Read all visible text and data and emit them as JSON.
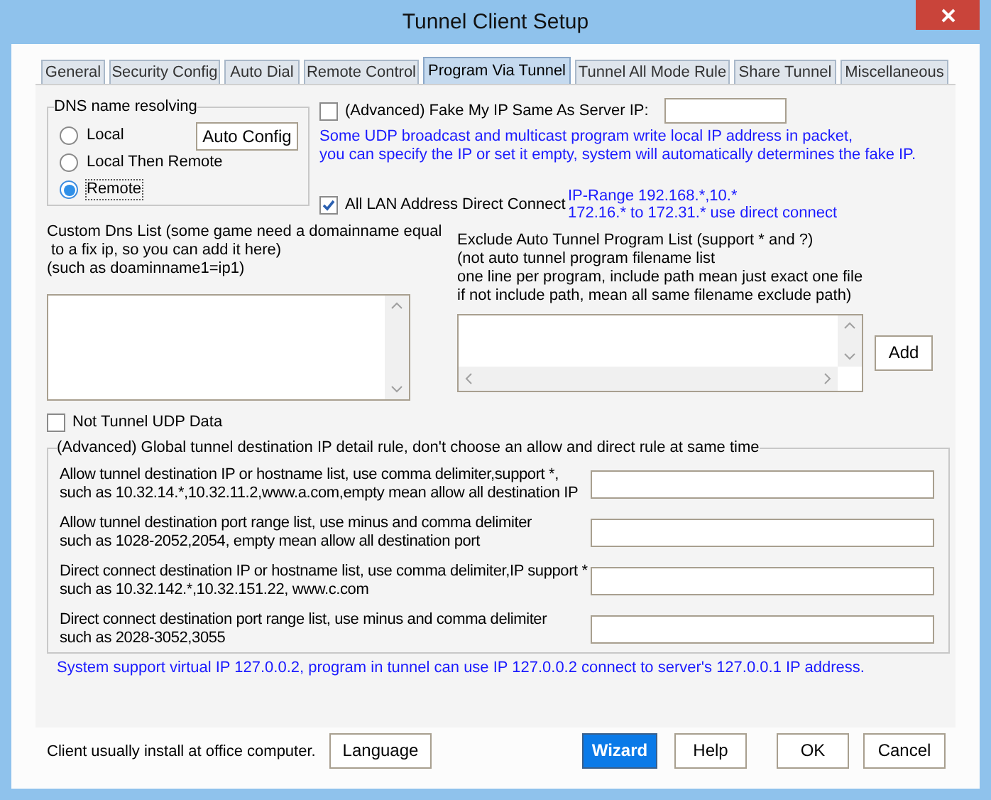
{
  "window": {
    "title": "Tunnel Client Setup"
  },
  "tabs": [
    {
      "label": "General",
      "selected": false
    },
    {
      "label": "Security Config",
      "selected": false
    },
    {
      "label": "Auto Dial",
      "selected": false
    },
    {
      "label": "Remote Control",
      "selected": false
    },
    {
      "label": "Program Via Tunnel",
      "selected": true
    },
    {
      "label": "Tunnel All Mode Rule",
      "selected": false
    },
    {
      "label": "Share Tunnel",
      "selected": false
    },
    {
      "label": "Miscellaneous",
      "selected": false
    }
  ],
  "dns_group": {
    "title": "DNS name resolving",
    "options": [
      {
        "label": "Local",
        "selected": false
      },
      {
        "label": "Local Then Remote",
        "selected": false
      },
      {
        "label": "Remote",
        "selected": true
      }
    ],
    "auto_config_button": "Auto Config"
  },
  "fake_ip": {
    "label": "(Advanced) Fake My IP Same As Server IP:",
    "checked": false
  },
  "fake_ip_note": [
    "Some UDP broadcast and multicast program write local IP address in packet,",
    "you can specify the IP or set it empty, system will automatically determines the fake IP."
  ],
  "all_lan": {
    "label": "All LAN Address Direct Connect",
    "checked": true
  },
  "ip_range_note": [
    "IP-Range 192.168.*,10.*",
    "172.16.* to 172.31.* use direct connect"
  ],
  "custom_dns": {
    "label": [
      "Custom Dns List (some game need a domainname equal",
      "to a fix ip, so you can add it here)",
      "(such as doaminname1=ip1)"
    ]
  },
  "exclude_list": {
    "label": [
      "Exclude Auto Tunnel Program List (support * and ?)",
      "(not auto tunnel program filename list",
      "one line per program, include path mean just exact one file",
      "if not include path, mean all same filename exclude path)"
    ],
    "add_button": "Add"
  },
  "not_tunnel_udp": {
    "label": "Not Tunnel UDP Data",
    "checked": false
  },
  "rules_group": {
    "title": "(Advanced) Global tunnel destination IP detail rule, don't choose an allow and direct rule at same time",
    "rules": [
      {
        "label": [
          "Allow tunnel destination IP or hostname list, use comma delimiter,support *,",
          "such as 10.32.14.*,10.32.11.2,www.a.com,empty mean allow all destination IP"
        ]
      },
      {
        "label": [
          "Allow tunnel destination port range list, use minus and comma delimiter",
          "such as 1028-2052,2054, empty mean allow all destination port"
        ]
      },
      {
        "label": [
          "Direct connect destination IP or hostname list, use comma delimiter,IP support *",
          "such as 10.32.142.*,10.32.151.22, www.c.com"
        ]
      },
      {
        "label": [
          "Direct connect destination port range list, use minus and comma delimiter",
          "such as 2028-3052,3055"
        ]
      }
    ]
  },
  "virtual_ip_note": "System support virtual IP 127.0.0.2, program in tunnel can use IP 127.0.0.2 connect to server's 127.0.0.1 IP address.",
  "footer": {
    "note": "Client usually install at office computer.",
    "buttons": [
      {
        "label": "Language",
        "kind": "normal"
      },
      {
        "label": "Wizard",
        "kind": "primary"
      },
      {
        "label": "Help",
        "kind": "normal"
      },
      {
        "label": "OK",
        "kind": "normal"
      },
      {
        "label": "Cancel",
        "kind": "normal"
      }
    ]
  }
}
